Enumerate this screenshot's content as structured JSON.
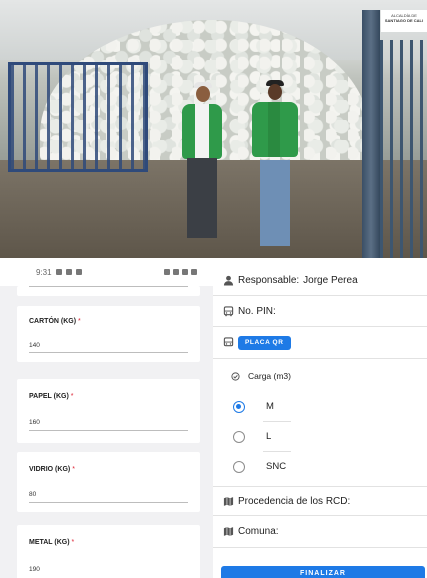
{
  "photo": {
    "logo_line1": "ALCALDÍA DE",
    "logo_line2": "SANTIAGO DE CALI"
  },
  "phone": {
    "status_time": "9:31",
    "cards": [
      {
        "label": "CARTÓN (KG)",
        "value": "140"
      },
      {
        "label": "PAPEL (KG)",
        "value": "160"
      },
      {
        "label": "VIDRIO (KG)",
        "value": "80"
      },
      {
        "label": "METAL (KG)",
        "value": "190"
      }
    ],
    "required_mark": "*"
  },
  "form": {
    "responsable_label": "Responsable:",
    "responsable_value": "Jorge Perea",
    "pin_label": "No. PIN:",
    "qr_button": "PLACA QR",
    "carga_label": "Carga (m3)",
    "options": [
      {
        "label": "M",
        "selected": true
      },
      {
        "label": "L",
        "selected": false
      },
      {
        "label": "SNC",
        "selected": false
      }
    ],
    "procedencia_label": "Procedencia de los RCD:",
    "comuna_label": "Comuna:",
    "finish_button": "FINALIZAR"
  },
  "colors": {
    "accent": "#1e7ae6",
    "vest": "#2f9a4a",
    "required": "#dd2233"
  }
}
